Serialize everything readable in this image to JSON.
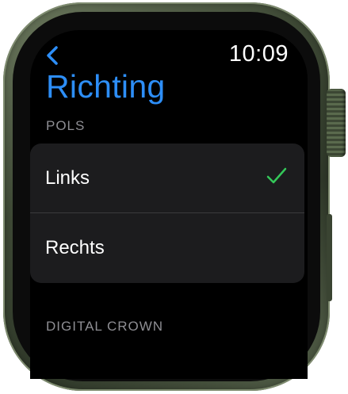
{
  "status_bar": {
    "time": "10:09",
    "back_icon": "chevron-left-icon"
  },
  "header": {
    "title": "Richting"
  },
  "sections": [
    {
      "header": "POLS",
      "options": [
        {
          "label": "Links",
          "selected": true
        },
        {
          "label": "Rechts",
          "selected": false
        }
      ]
    },
    {
      "header": "DIGITAL CROWN"
    }
  ],
  "colors": {
    "accent": "#2d8ef7",
    "check": "#34c759",
    "row_background": "#1c1c1e",
    "section_header": "#8e8e93"
  }
}
